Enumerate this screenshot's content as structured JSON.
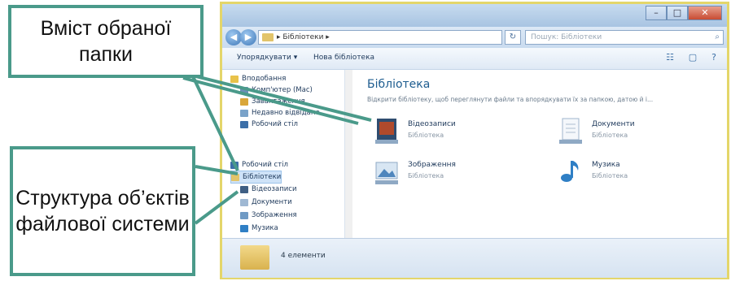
{
  "window": {
    "address": "▸ Бібліотеки ▸",
    "search_placeholder": "Пошук: Бібліотеки",
    "toolbar": {
      "organize": "Упорядкувати ▾",
      "new_library": "Нова бібліотека"
    }
  },
  "nav": {
    "favorites": [
      "Вподобання",
      "Комп'ютер (Mac)",
      "Завантаження",
      "Недавно відвідане",
      "Робочий стіл"
    ],
    "desktop": "Робочий стіл",
    "libraries": "Бібліотеки",
    "library_children": [
      "Відеозаписи",
      "Документи",
      "Зображення",
      "Музика"
    ]
  },
  "content": {
    "title": "Бібліотека",
    "description": "Відкрити бібліотеку, щоб переглянути файли та впорядкувати їх за папкою, датою й і...",
    "libraries": [
      {
        "name": "Відеозаписи",
        "subtitle": "Бібліотека",
        "icon": "video-library-icon"
      },
      {
        "name": "Документи",
        "subtitle": "Бібліотека",
        "icon": "documents-library-icon"
      },
      {
        "name": "Зображення",
        "subtitle": "Бібліотека",
        "icon": "pictures-library-icon"
      },
      {
        "name": "Музика",
        "subtitle": "Бібліотека",
        "icon": "music-library-icon"
      }
    ]
  },
  "status": {
    "count": "4 елементи"
  },
  "callouts": {
    "folder_contents": "Вміст обраної папки",
    "structure": "Структура об’єктів файлової системи"
  },
  "colors": {
    "callout_border": "#4a9a8a",
    "window_border": "#e4d66a",
    "title_accent": "#1d5c8f"
  }
}
